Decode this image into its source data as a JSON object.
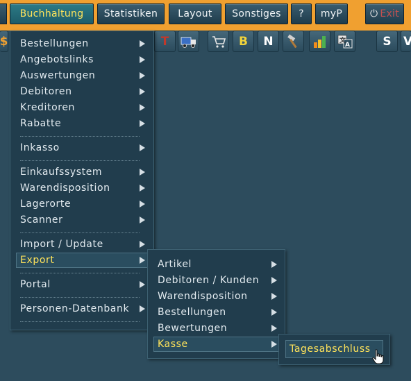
{
  "menubar": {
    "items": [
      {
        "label": "Buchhaltung",
        "active": true
      },
      {
        "label": "Statistiken"
      },
      {
        "label": "Layout"
      },
      {
        "label": "Sonstiges"
      },
      {
        "label": "?"
      },
      {
        "label": "myP"
      }
    ],
    "exit_label": "Exit",
    "exit_icon": "power-icon"
  },
  "toolbar": {
    "dollar_glyph": "$",
    "t_glyph": "T",
    "b_glyph": "B",
    "n_glyph": "N",
    "s_glyph": "S",
    "v_glyph": "V"
  },
  "menu_main": {
    "items": [
      {
        "label": "Bestellungen",
        "submenu": true
      },
      {
        "label": "Angebotslinks",
        "submenu": true
      },
      {
        "label": "Auswertungen",
        "submenu": true
      },
      {
        "label": "Debitoren",
        "submenu": true
      },
      {
        "label": "Kreditoren",
        "submenu": true
      },
      {
        "label": "Rabatte",
        "submenu": true
      },
      {
        "label": "Inkasso",
        "submenu": true
      },
      {
        "label": "Einkaufssystem",
        "submenu": true
      },
      {
        "label": "Warendisposition",
        "submenu": true
      },
      {
        "label": "Lagerorte",
        "submenu": true
      },
      {
        "label": "Scanner",
        "submenu": true
      },
      {
        "label": "Import / Update",
        "submenu": true
      },
      {
        "label": "Export",
        "submenu": true,
        "highlighted": true
      },
      {
        "label": "Portal",
        "submenu": true
      },
      {
        "label": "Personen-Datenbank",
        "submenu": true
      }
    ]
  },
  "menu_export": {
    "items": [
      {
        "label": "Artikel",
        "submenu": true
      },
      {
        "label": "Debitoren / Kunden",
        "submenu": true
      },
      {
        "label": "Warendisposition",
        "submenu": true
      },
      {
        "label": "Bestellungen",
        "submenu": true
      },
      {
        "label": "Bewertungen",
        "submenu": true
      },
      {
        "label": "Kasse",
        "submenu": true,
        "highlighted": true
      }
    ]
  },
  "menu_kasse": {
    "items": [
      {
        "label": "Tagesabschluss",
        "highlighted": true
      }
    ]
  },
  "colors": {
    "menubar_bg": "#f0a030",
    "page_bg": "#2d4c5d",
    "highlight_text": "#ffe35a",
    "exit_text": "#c25050"
  }
}
